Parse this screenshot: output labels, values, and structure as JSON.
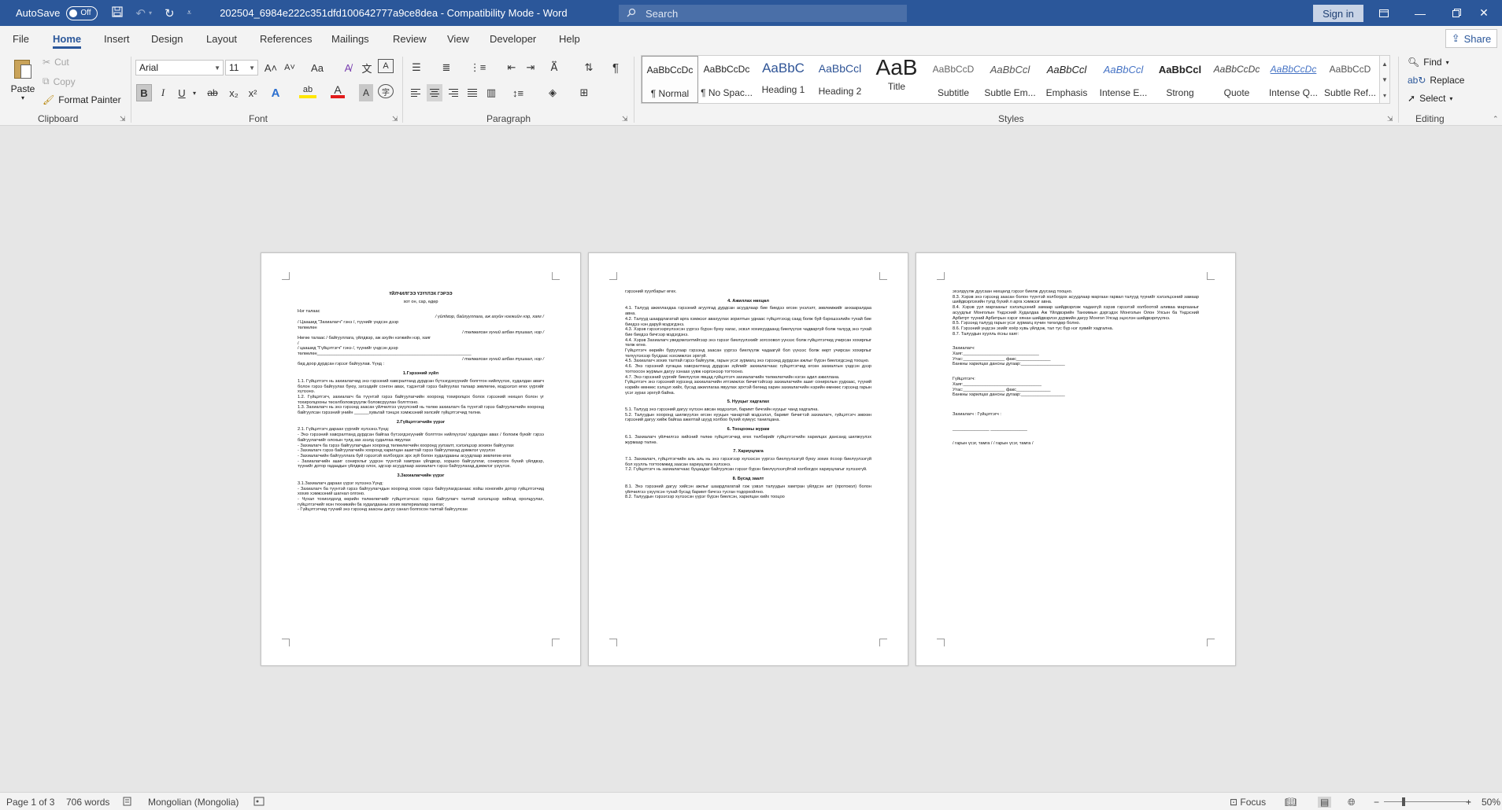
{
  "titlebar": {
    "autosave_label": "AutoSave",
    "autosave_state": "Off",
    "doc_title": "202504_6984e222c351dfd100642777a9ce8dea  -  Compatibility Mode  -  Word",
    "search_placeholder": "Search",
    "signin_label": "Sign in"
  },
  "menu": {
    "tabs": [
      "File",
      "Home",
      "Insert",
      "Design",
      "Layout",
      "References",
      "Mailings",
      "Review",
      "View",
      "Developer",
      "Help"
    ],
    "active_tab": "Home",
    "share_label": "Share"
  },
  "clipboard": {
    "paste": "Paste",
    "cut": "Cut",
    "copy": "Copy",
    "format_painter": "Format Painter",
    "group": "Clipboard"
  },
  "font": {
    "name": "Arial",
    "size": "11",
    "group": "Font",
    "grow": "A˄",
    "shrink": "A˅",
    "case": "Aa",
    "bold": "B",
    "italic": "I",
    "underline": "U",
    "strike": "ab",
    "subscript": "x₂",
    "superscript": "x²",
    "effects": "A",
    "highlight": "ab",
    "color": "A",
    "shade": "A",
    "enclose": "字"
  },
  "paragraph": {
    "group": "Paragraph",
    "pilcrow": "¶"
  },
  "styles": {
    "group": "Styles",
    "items": [
      {
        "sample": "AaBbCcDc",
        "name": "¶ Normal"
      },
      {
        "sample": "AaBbCcDc",
        "name": "¶ No Spac..."
      },
      {
        "sample": "AaBbC",
        "name": "Heading 1"
      },
      {
        "sample": "AaBbCcl",
        "name": "Heading 2"
      },
      {
        "sample": "AaB",
        "name": "Title"
      },
      {
        "sample": "AaBbCcD",
        "name": "Subtitle"
      },
      {
        "sample": "AaBbCcl",
        "name": "Subtle Em..."
      },
      {
        "sample": "AaBbCcl",
        "name": "Emphasis"
      },
      {
        "sample": "AaBbCcl",
        "name": "Intense E..."
      },
      {
        "sample": "AaBbCcl",
        "name": "Strong"
      },
      {
        "sample": "AaBbCcDc",
        "name": "Quote"
      },
      {
        "sample": "AaBbCcDc",
        "name": "Intense Q..."
      },
      {
        "sample": "AaBbCcD",
        "name": "Subtle Ref..."
      }
    ]
  },
  "editing": {
    "group": "Editing",
    "find": "Find",
    "replace": "Replace",
    "select": "Select"
  },
  "pages": {
    "p1": [
      {
        "t": "h",
        "v": "ҮЙЛЧИЛГЭЭ ҮЗҮҮЛЭХ ГЭРЭЭ"
      },
      {
        "t": "c",
        "v": "хот                                                                                        он, сар, өдөр"
      },
      {
        "t": "sp",
        "v": ""
      },
      {
        "t": "j",
        "v": "Нэг талаас"
      },
      {
        "t": "r",
        "v": "/ үйлдвэр, байгууллага, аж ахуйн нэгжийн нэр, хаяг /"
      },
      {
        "t": "j",
        "v": "/ Цаашид \"Захиалагч\" гэнэ /, түүнийг                                                                  үндсэн дээр"
      },
      {
        "t": "j",
        "v": "төлөөлөн"
      },
      {
        "t": "r",
        "v": "/ төлөөлсөн хүний албан тушаал, нэр /"
      },
      {
        "t": "j",
        "v": "Нөгөө талаас                                          / байгууллага, үйлдвэр, аж ахуйн нэгжийн нэр, хаяг"
      },
      {
        "t": "j",
        "v": "/"
      },
      {
        "t": "j",
        "v": "/ цаашид \"Гүйцэтгэгч\" гэнэ /, түүнийг                                                                   үндсэн дээр"
      },
      {
        "t": "j",
        "v": "төлөөлөн_______________________________________________________________"
      },
      {
        "t": "r",
        "v": "/ төлөөлсөн хүний албан тушаал, нэр /"
      },
      {
        "t": "j",
        "v": "бид доор дурдсан гэрээг байгуулав. Үүнд :"
      },
      {
        "t": "h",
        "v": "1.Гэрээний зүйл"
      },
      {
        "t": "j",
        "v": "1.1. Гүйцэтгэгч нь захиалагчид                           энэ гэрээний хавсралтанд дурдсан бүтээгдэхүүнийг болгтгон нийлүүлэх, худалдан авагч болон гэрээ байгуулах буюу, эзгээдийг сонгон авах, тэдэнтэй гэрээ байгуулах талаар зөвлөгөө, мэдээлэл өгөх үүргийг хүлээнэ."
      },
      {
        "t": "j",
        "v": "1.2. Гүйцэтгэгч, захиалагч ба түүнтэй гэрээ байгуулагчийн хооронд тохиролцох болох гэрээний нөхцөл болон үг тохиролцооны төсөлболовсруулж боловсруулан болгтгоно."
      },
      {
        "t": "j",
        "v": "1.3. Захиалагч нь энэ гэрээнд заасан үйлчилгээ үзүүлсний нь төлөө захиалагч ба түүнтэй гэрээ байгуулагчийн хооронд байгуулсан гэрээний үнийн ______хувьтай тэнцэх хэмжээний хөлсийг гүйцэтгэгчид төлнө."
      },
      {
        "t": "h",
        "v": "2.Гүйцэтгэгчийн үүрэг"
      },
      {
        "t": "j",
        "v": "2.1. Гүйцэтгэгч дараах үүргийг хүлээнэ.Үүнд:"
      },
      {
        "t": "j",
        "v": "- Энэ гэрээний хавсралтанд дурдсан байгаа бүтээгдэхүүнийг болгтгон нийлүүлэх/ худалдан авах / болоиж буюйг гэрээ байгуулагчийг олохын тулд зах зээлд судалгаа явуулах"
      },
      {
        "t": "j",
        "v": "- Захиалагч ба гэрээ байгуулагчдын хооронд төлөөлөгчийн хооронд уулзалт, хэлэлцээр зохион байгуулах"
      },
      {
        "t": "j",
        "v": "- Захиалагч гэрээ байгуулагчийн хооронд харилцан ашигтай гэрээ байгуулахад дэмжлэг үзүүлэх"
      },
      {
        "t": "j",
        "v": "- Захиалагчийн байгууллага буй гэрээтэй холбогдох эрх зүй болон худалдааны асуудлаар зөвлөгөө өгөх"
      },
      {
        "t": "j",
        "v": "- Захиалагчийн ашиг сонирхлыг уудхэн түүнтэй хамтран үйлдвэр, хоршоо байгууллаг, сонирхсон бүхий үйлдвэр, түүнийг дотор гадаадын үйлдвэр олох, эдгээр асуудлаар захиалагч гэрээ байгуулахад дэмжлэг үзүүлэх."
      },
      {
        "t": "h",
        "v": "3.Захиалагчийн үүрэг"
      },
      {
        "t": "j",
        "v": "3.1.Захиалагч дараах үүрэг хүлээнэ.Үүнд:"
      },
      {
        "t": "j",
        "v": "- Захиалагч ба түүнтэй гэрээ байгуулагчдын хооронд хохих гэрээ байгуулагдсанаас хойш          хоногийн дотор гүйцэтгэгчид хохих хэмжээний шагнал олгоно."
      },
      {
        "t": "j",
        "v": "- Чухал тохиолдолд өөрийн төлөөлөгчийг гүйцэтгэгчээс гэрээ байгуулагч талтай хэлэлцээр хийхэд оролцуулах, гүйцэтгэгчийг мэн техникийн ба худалдааны зохих материалаар хангах;"
      },
      {
        "t": "j",
        "v": "- Гүйцэтгэгчид түүний энэ гэрээнд заасны дагуу санал болгосон талтай байгуулсан"
      }
    ],
    "p2": [
      {
        "t": "j",
        "v": "гэрээний хуулбарыг өгөх."
      },
      {
        "t": "h",
        "v": "4. Ажиллах нөхцөл"
      },
      {
        "t": "j",
        "v": "4.1. Талууд ажиллахдаа гэрээний агуулгад дурдсан асуудлаар бие биедээ өгсөн үнэлэлт, зөвлөмжийг анхааралдаа авна."
      },
      {
        "t": "j",
        "v": "4.2. Талууд шаардлагатай арга хэмжээг авахуулах зорилтын уднаас гүйцэтгэхэд саад болж буй бэрхшээлийн тухай бие биедээ нэн даруй мэдэгдэнэ."
      },
      {
        "t": "j",
        "v": "4.3. Хэрэв гэрээгээрхүлээсэн үүргээ бүрэн буюу хагас, эсвэл хохихуудаанд биелүүлэх чадваргүй болж талууд энэ тухай бие биедээ бичгээр мэдэгдэнэ."
      },
      {
        "t": "j",
        "v": "4.4. Хэрэв Захиалагч уведомлэлтийгээр энэ гэрээг биелүүлэхийг зогсоовол үүнээс болж гүйцэтгэгчид учирсан хохирлыг төлж өгнө."
      },
      {
        "t": "j",
        "v": "Гүйцэтгэгч өөрийн буруугаар гэрээнд заасан үүргээ биелүүлж чадаагүй бол үүнээс болж өөрт учирсан хохирлыг төлүүлэхээр бусдаас нэхэмжлэх эрхгүй."
      },
      {
        "t": "j",
        "v": "4.5. Захиалагч зохих талтай гэрээ байгуулж, гарын үсэг зурмагц энэ гэрээнд дурдсан ажлыг бүрэн биелэгдсэнд тооцно."
      },
      {
        "t": "j",
        "v": "4.6. Энэ гэрээний хугацаа хавсралтанд дурдсан зүйлийг захиалагчаас гүйцэтгэгчид өгсөн захиалгын үндсэн дээр тогтоосон журмын дагуу хэнаах уувж нэрлэнээр тогтооно."
      },
      {
        "t": "j",
        "v": "4.7. Энэ гэрээний үүргийг биелүүлэх явцад гүйцэтгэгч захиалагчийн төлөөлөгчийн нэгэн адил ажиллана."
      },
      {
        "t": "j",
        "v": "Гүйцэтгэгч энэ гэрээний хүрээнд захиалагчийн итгэмжлэх бичигтэйгээр захиалагчийн ашиг сонирхлын уудхаас, түүний нэрийн өмнөөс хэлцэл хийх, бусад ажиллагаа явуулах эрхтэй бөгөөд харин захиалагчийн нэрийн өмнөөс гэрээнд гарын үсэг зурах эрхгүй байна."
      },
      {
        "t": "h",
        "v": "5. Нууцыг хадгалах"
      },
      {
        "t": "j",
        "v": "5.1. Талууд энэ гэрээний дагуу хүлээн авсан мэдээлэл, баримт бичгийн нууцыг чанд хадгална."
      },
      {
        "t": "j",
        "v": "5.2. Талуудын хооронд шилжүүлэн өгсөн нууцын чанартай мэдээлэл, баримт бичигтэй захиалагч, гүйцэтгэгч зөвхөн гэрээний дагуу хийж байгаа ажилтай шууд холбоо бүхий хүмүүс танилцана."
      },
      {
        "t": "h",
        "v": "6. Тооцооны журам"
      },
      {
        "t": "j",
        "v": "6.1. Захиалагч үйлчилгээ хийсний төлөө гүйцэтгэгчид өгөх төлбөрийг гүйцэтгэгчийн харилцах дансанд шилжүүлэх журмаар төлнө."
      },
      {
        "t": "h",
        "v": "7. Хариуцлага"
      },
      {
        "t": "j",
        "v": "7.1. Захиалагч, гүйцэтгэгчийн аль аль нь энэ гэрээгээр хүлээсэн үүргээ биелүүлээгүй буюу зохих ёсоор биелүүлээгүй бол хуулль тогтоомжид заасан хариуцлага хүлээнэ."
      },
      {
        "t": "j",
        "v": "7.2. Гүйцэтгэгч нь захиалагчаас буцаадаг байгуулсан гэрээг бүрэн биелүүлээгүйтэй холбогдох хариуцлагыг хүлээхгүй."
      },
      {
        "t": "h",
        "v": "8. Бусад заалт"
      },
      {
        "t": "j",
        "v": "8.1. Энэ гэрээний дагуу хийсэн ажлыг шаардлагатай гэж үзвэл талуудын хамтран үйлдсэн акт (протокол) болон үйлчилгээ үзүүлсэн тухай бусад баримт бичгээ тусган тодорхойлно."
      },
      {
        "t": "j",
        "v": "8.2. Талуудын гэрээгээр хүлээсэн үүрэг бүрэн биелсэн, харилцан хийх тооцоо"
      }
    ],
    "p3": [
      {
        "t": "j",
        "v": "эхэлдүүлж дуусаан нөхцөлд гэрээг биелж дуусанд тооцно."
      },
      {
        "t": "j",
        "v": "8.3. Хэрэв энэ гэрээнд заасан болон түүнтэй холбогдох асуудлаар маргаан гарвал талууд түүнийг хэлэлцээний замаар шийдвэрлэхийн тулд бүхий л арга хэмжээг авна."
      },
      {
        "t": "j",
        "v": "8.4. Хэрэв уул маргааныг хэлэлцээний замаар шийдвэрлэж чадахгүй хэрэв гэрээтэй холбоотой аливаа маргааныг асуудлыг Монголын Үндэсний Худалдаа Аж Үйлдвэрийн Танхимын дэргэдэх Монголын Олон Улсын ба Үндэсний Арбитрт түүний Арбитрын хэрэг хянан шийдвэрлэх дүрмийн дагуу Монгол Улсад эцэслэн шийдвэрлүүлнэ."
      },
      {
        "t": "j",
        "v": "8.5. Гэрээнд талууд гарын үсэг зурмагц хүчин төгөлдөр болно."
      },
      {
        "t": "j",
        "v": "8.6. Гэрээний үндсэн эхийг хоёр хувь үйлдэж, тал тус бүр нэг хувийг хадгална."
      },
      {
        "t": "j",
        "v": "8.7. Талуудын хуулль ёсны хаяг:"
      },
      {
        "t": "sp",
        "v": ""
      },
      {
        "t": "sp",
        "v": ""
      },
      {
        "t": "j",
        "v": "Захиалагч:"
      },
      {
        "t": "j",
        "v": "Хаяг:_______________________________"
      },
      {
        "t": "j",
        "v": "Утас:_________________  факс______________"
      },
      {
        "t": "j",
        "v": "Банкны харилцах дансны дугаар:__________________"
      },
      {
        "t": "sp",
        "v": ""
      },
      {
        "t": "sp",
        "v": ""
      },
      {
        "t": "j",
        "v": "Гүйцэтгэгч:"
      },
      {
        "t": "j",
        "v": "Хаяг:________________________________"
      },
      {
        "t": "j",
        "v": "Утас:_________________  факс______________"
      },
      {
        "t": "j",
        "v": "Банкны харилцах дансны дугаар:__________________"
      },
      {
        "t": "sp",
        "v": ""
      },
      {
        "t": "sp",
        "v": ""
      },
      {
        "t": "sp",
        "v": ""
      },
      {
        "t": "j",
        "v": "          Захиалагч :                                                                           Гүйцэтгэгч :"
      },
      {
        "t": "sp",
        "v": ""
      },
      {
        "t": "sp",
        "v": ""
      },
      {
        "t": "j",
        "v": "_______________                                                            _______________"
      },
      {
        "t": "sp",
        "v": ""
      },
      {
        "t": "sp",
        "v": ""
      },
      {
        "t": "j",
        "v": "/ гарын үсэг, тамга /                                                    / гарын үсэг, тамга /"
      }
    ]
  },
  "status": {
    "page": "Page 1 of 3",
    "words": "706 words",
    "language": "Mongolian (Mongolia)",
    "focus": "Focus",
    "zoom": "50%"
  },
  "colors": {
    "accent": "#2b579a",
    "ribbon_bg": "#f3f3f3",
    "canvas_bg": "#e6e6e6"
  }
}
